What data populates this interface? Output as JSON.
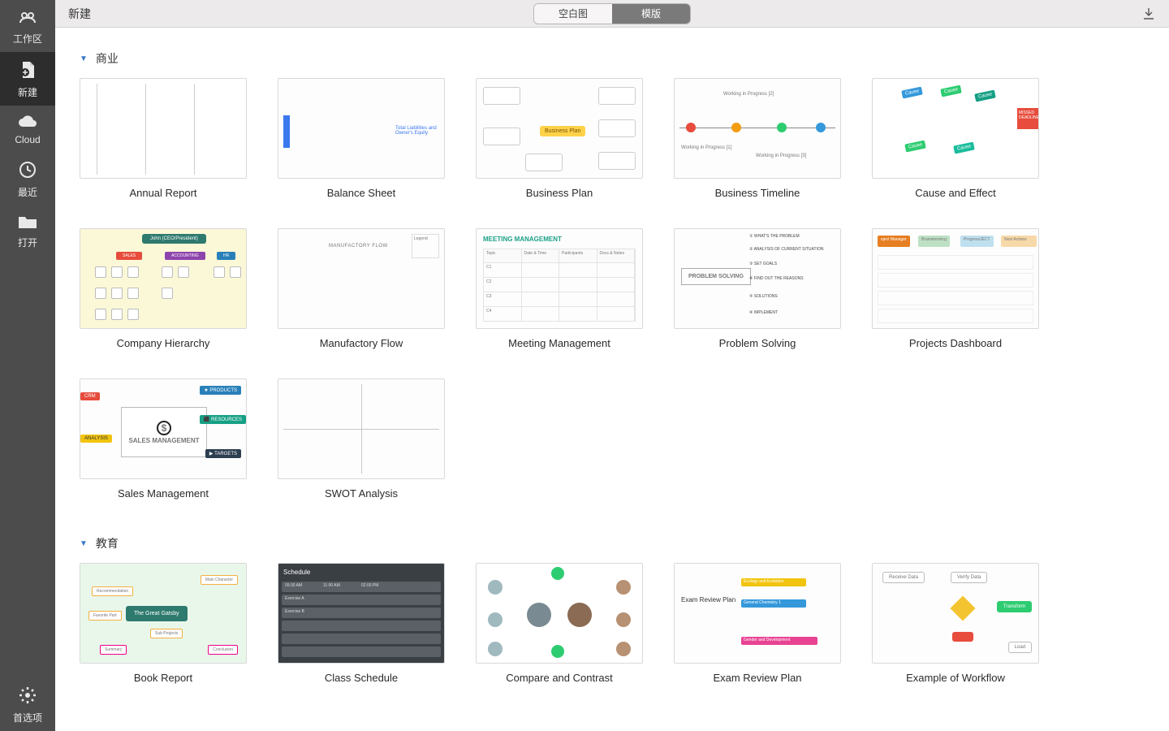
{
  "topbar": {
    "title": "新建",
    "seg_blank": "空白图",
    "seg_template": "模版"
  },
  "sidebar": {
    "workspace": "工作区",
    "new": "新建",
    "cloud": "Cloud",
    "recent": "最近",
    "open": "打开",
    "prefs": "首选项"
  },
  "sections": [
    {
      "title": "商业",
      "templates": [
        {
          "name": "Annual Report",
          "thumb": "annual"
        },
        {
          "name": "Balance Sheet",
          "thumb": "balance"
        },
        {
          "name": "Business Plan",
          "thumb": "bplan"
        },
        {
          "name": "Business Timeline",
          "thumb": "btimeline"
        },
        {
          "name": "Cause and Effect",
          "thumb": "cause"
        },
        {
          "name": "Company Hierarchy",
          "thumb": "hier"
        },
        {
          "name": "Manufactory Flow",
          "thumb": "flow"
        },
        {
          "name": "Meeting Management",
          "thumb": "meeting"
        },
        {
          "name": "Problem Solving",
          "thumb": "problem"
        },
        {
          "name": "Projects Dashboard",
          "thumb": "dash"
        },
        {
          "name": "Sales Management",
          "thumb": "sales"
        },
        {
          "name": "SWOT Analysis",
          "thumb": "swot"
        }
      ]
    },
    {
      "title": "教育",
      "templates": [
        {
          "name": "Book Report",
          "thumb": "book"
        },
        {
          "name": "Class Schedule",
          "thumb": "sched"
        },
        {
          "name": "Compare and Contrast",
          "thumb": "compare"
        },
        {
          "name": "Exam Review Plan",
          "thumb": "exam"
        },
        {
          "name": "Example of Workflow",
          "thumb": "workflow"
        }
      ]
    }
  ],
  "thumb_text": {
    "bplan": "Business Plan",
    "hier_boss": "John (CEO/President)",
    "meeting_hdr": "MEETING MANAGEMENT",
    "meeting_cols": [
      "Topic",
      "Date & Time",
      "Participants",
      "Docs & Notes"
    ],
    "problem_box": "PROBLEM SOLVING",
    "problem_steps": [
      "① WHAT'S THE PROBLEM",
      "② ANALYSIS OF CURRENT SITUATION",
      "③ SET GOALS",
      "④ FIND OUT THE REASONS",
      "⑤ SOLUTIONS",
      "⑥ IMPLEMENT"
    ],
    "sales_center": "SALES MANAGEMENT",
    "sales_tags": {
      "products": "★ PRODUCTS",
      "resources": "⬛ RESOURCES",
      "targets": "▶ TARGETS",
      "crm": "CRM",
      "analysis": "ANALYSIS"
    },
    "book_center": "The Great Gatsby",
    "sched_title": "Schedule",
    "exam_center": "Exam Review Plan",
    "cause_deadline": "MISSED DEADLINE",
    "btimeline_labels": [
      "Working in Progress [1]",
      "Working in Progress [2]",
      "Working in Progress [3]"
    ]
  }
}
